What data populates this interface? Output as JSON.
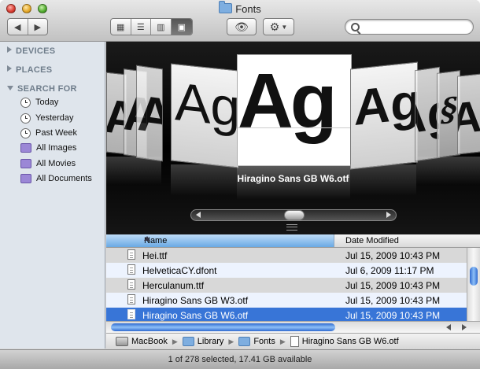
{
  "window": {
    "title": "Fonts"
  },
  "toolbar": {
    "view_buttons": [
      "icon-view",
      "list-view",
      "column-view",
      "coverflow-view"
    ],
    "active_view": "coverflow-view",
    "search": {
      "value": "",
      "placeholder": ""
    }
  },
  "sidebar": {
    "devices_label": "DEVICES",
    "places_label": "PLACES",
    "search_for_label": "SEARCH FOR",
    "search_items": [
      {
        "label": "Today",
        "icon": "clock-icon"
      },
      {
        "label": "Yesterday",
        "icon": "clock-icon"
      },
      {
        "label": "Past Week",
        "icon": "clock-icon"
      },
      {
        "label": "All Images",
        "icon": "smart-folder-icon"
      },
      {
        "label": "All Movies",
        "icon": "smart-folder-icon"
      },
      {
        "label": "All Documents",
        "icon": "smart-folder-icon"
      }
    ]
  },
  "coverflow": {
    "sample_glyphs": "Ag",
    "current_caption": "Hiragino Sans GB W6.otf"
  },
  "list": {
    "columns": {
      "name": "Name",
      "date": "Date Modified"
    },
    "rows": [
      {
        "name": "Hei.ttf",
        "date": "Jul 15, 2009 10:43 PM",
        "selected": false
      },
      {
        "name": "HelveticaCY.dfont",
        "date": "Jul 6, 2009 11:17 PM",
        "selected": false
      },
      {
        "name": "Herculanum.ttf",
        "date": "Jul 15, 2009 10:43 PM",
        "selected": false
      },
      {
        "name": "Hiragino Sans GB W3.otf",
        "date": "Jul 15, 2009 10:43 PM",
        "selected": false
      },
      {
        "name": "Hiragino Sans GB W6.otf",
        "date": "Jul 15, 2009 10:43 PM",
        "selected": true
      }
    ]
  },
  "pathbar": {
    "segments": [
      {
        "label": "MacBook",
        "icon": "hard-drive-icon"
      },
      {
        "label": "Library",
        "icon": "folder-icon"
      },
      {
        "label": "Fonts",
        "icon": "folder-icon"
      },
      {
        "label": "Hiragino Sans GB W6.otf",
        "icon": "document-icon"
      }
    ]
  },
  "status": {
    "text": "1 of 278 selected, 17.41 GB available"
  },
  "colors": {
    "selection": "#3875d7",
    "sidebar_bg": "#dfe5ec",
    "coverflow_bg": "#000000"
  }
}
